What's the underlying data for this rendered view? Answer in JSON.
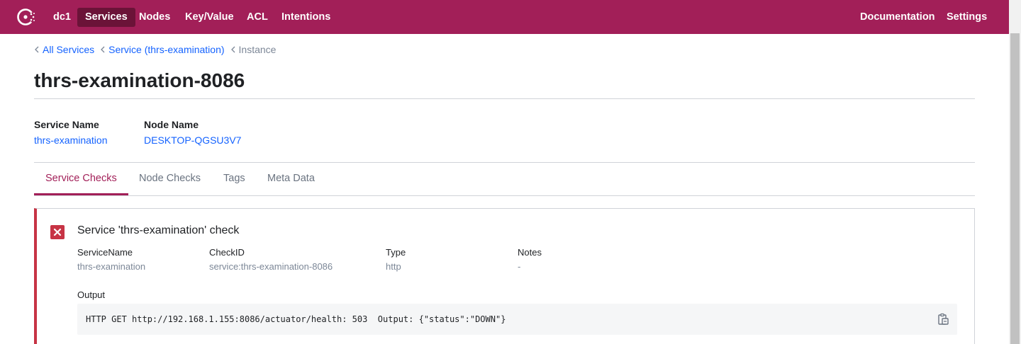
{
  "nav": {
    "datacenter": "dc1",
    "items": [
      {
        "label": "Services",
        "active": true
      },
      {
        "label": "Nodes"
      },
      {
        "label": "Key/Value"
      },
      {
        "label": "ACL"
      },
      {
        "label": "Intentions"
      }
    ],
    "right_items": [
      {
        "label": "Documentation"
      },
      {
        "label": "Settings"
      }
    ]
  },
  "breadcrumb": {
    "items": [
      "All Services",
      "Service (thrs-examination)"
    ],
    "current": "Instance"
  },
  "page": {
    "title": "thrs-examination-8086"
  },
  "info": {
    "service_name_label": "Service Name",
    "service_name_value": "thrs-examination",
    "node_name_label": "Node Name",
    "node_name_value": "DESKTOP-QGSU3V7"
  },
  "tabs": [
    {
      "label": "Service Checks",
      "active": true
    },
    {
      "label": "Node Checks"
    },
    {
      "label": "Tags"
    },
    {
      "label": "Meta Data"
    }
  ],
  "check": {
    "status": "critical",
    "title": "Service 'thrs-examination' check",
    "fields": [
      {
        "label": "ServiceName",
        "value": "thrs-examination"
      },
      {
        "label": "CheckID",
        "value": "service:thrs-examination-8086"
      },
      {
        "label": "Type",
        "value": "http"
      },
      {
        "label": "Notes",
        "value": "-"
      }
    ],
    "output_label": "Output",
    "output_text": "HTTP GET http://192.168.1.155:8086/actuator/health: 503  Output: {\"status\":\"DOWN\"}"
  },
  "colors": {
    "brand": "#a21f58",
    "brand_dark": "#6b1338",
    "link": "#1563ff",
    "critical": "#c73445"
  },
  "icons": {
    "logo": "consul-logo-icon",
    "chevron": "chevron-left-icon",
    "status": "fail-x-icon",
    "copy": "clipboard-copy-icon"
  }
}
